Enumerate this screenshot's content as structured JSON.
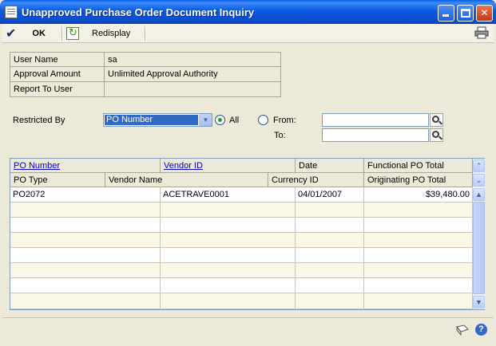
{
  "window": {
    "title": "Unapproved Purchase Order Document Inquiry",
    "minimize_label": "_",
    "maximize_label": "□",
    "close_label": "✕"
  },
  "toolbar": {
    "ok_label": "OK",
    "redisplay_label": "Redisplay"
  },
  "info": {
    "user_name_label": "User Name",
    "user_name_value": "sa",
    "approval_amount_label": "Approval Amount",
    "approval_amount_value": "Unlimited Approval Authority",
    "report_to_user_label": "Report To User",
    "report_to_user_value": ""
  },
  "restrict": {
    "restricted_by_label": "Restricted By",
    "restricted_by_value": "PO Number",
    "all_label": "All",
    "from_label": "From:",
    "to_label": "To:",
    "from_value": "",
    "to_value": "",
    "selected": "All"
  },
  "grid": {
    "header_row1": [
      "PO Number",
      "Vendor ID",
      "Date",
      "Functional PO Total"
    ],
    "header_row2": [
      "PO Type",
      "Vendor Name",
      "Currency ID",
      "Originating PO Total"
    ],
    "rows": [
      [
        "PO2072",
        "ACETRAVE0001",
        "04/01/2007",
        "$39,480.00"
      ]
    ]
  },
  "colors": {
    "titlebar": "#0a4fd0",
    "selection": "#316ac5",
    "link": "#0000cc",
    "row_alt": "#fbf7e6"
  }
}
